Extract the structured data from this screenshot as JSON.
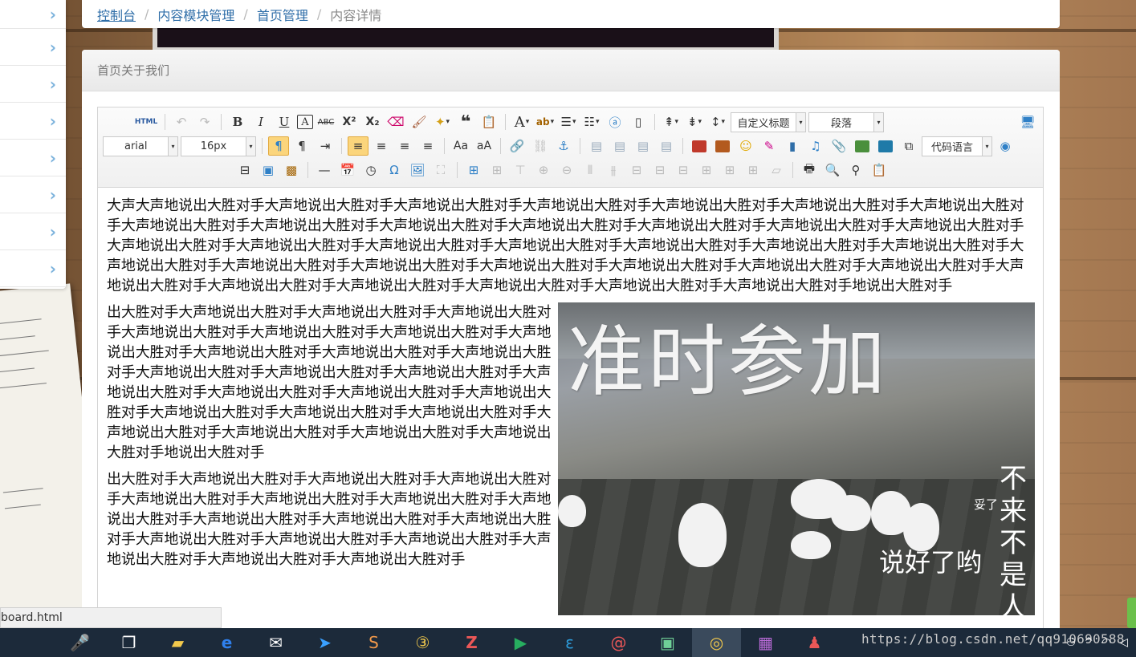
{
  "sidebar": {
    "items": [
      {
        "chevron": "›"
      },
      {
        "chevron": "›"
      },
      {
        "chevron": "›"
      },
      {
        "chevron": "›"
      },
      {
        "chevron": "›"
      },
      {
        "chevron": "›"
      },
      {
        "chevron": "›"
      },
      {
        "chevron": "›"
      }
    ]
  },
  "breadcrumb": {
    "items": [
      "控制台",
      "内容模块管理",
      "首页管理"
    ],
    "separator": "/",
    "current": "内容详情"
  },
  "panel": {
    "title": "首页关于我们"
  },
  "toolbar": {
    "html_label": "HTML",
    "font_family": "arial",
    "font_size": "16px",
    "custom_title": "自定义标题",
    "paragraph": "段落",
    "code_language": "代码语言",
    "row1_icons": [
      "undo-icon",
      "redo-icon",
      "bold-icon",
      "italic-icon",
      "underline-icon",
      "font-border-icon",
      "strikethrough-icon",
      "superscript-icon",
      "subscript-icon",
      "eraser-icon",
      "format-brush-icon",
      "auto-typeset-icon",
      "blockquote-icon",
      "paste-plain-icon",
      "font-color-icon",
      "background-color-icon",
      "ordered-list-icon",
      "unordered-list-icon",
      "select-all-icon",
      "clear-doc-icon",
      "row-spacing-top-icon",
      "row-spacing-bottom-icon",
      "line-height-icon",
      "preview-icon"
    ],
    "glyphs": {
      "bold": "B",
      "italic": "I",
      "underline": "U",
      "fontborder": "A",
      "strike": "ABC",
      "superscript": "X²",
      "subscript": "X₂",
      "quote": "❝",
      "fontcolor": "A",
      "omega": "Ω",
      "hr": "—"
    }
  },
  "content": {
    "paragraph1": "大声大声地说出大胜对手大声地说出大胜对手大声地说出大胜对手大声地说出大胜对手大声地说出大胜对手大声地说出大胜对手大声地说出大胜对手大声地说出大胜对手大声地说出大胜对手大声地说出大胜对手大声地说出大胜对手大声地说出大胜对手大声地说出大胜对手大声地说出大胜对手大声地说出大胜对手大声地说出大胜对手大声地说出大胜对手大声地说出大胜对手大声地说出大胜对手大声地说出大胜对手大声地说出大胜对手大声地说出大胜对手大声地说出大胜对手大声地说出大胜对手大声地说出大胜对手大声地说出大胜对手大声地说出大胜对手大声地说出大胜对手大声地说出大胜对手大声地说出大胜对手大声地说出大胜对手大声地说出大胜对手大声地说出大胜对手大声地说出大胜对手地说出大胜对手",
    "paragraph2": "出大胜对手大声地说出大胜对手大声地说出大胜对手大声地说出大胜对手大声地说出大胜对手大声地说出大胜对手大声地说出大胜对手大声地说出大胜对手大声地说出大胜对手大声地说出大胜对手大声地说出大胜对手大声地说出大胜对手大声地说出大胜对手大声地说出大胜对手大声地说出大胜对手大声地说出大胜对手大声地说出大胜对手大声地说出大胜对手大声地说出大胜对手大声地说出大胜对手大声地说出大胜对手大声地说出大胜对手大声地说出大胜对手大声地说出大胜对手大声地说出大胜对手地说出大胜对手",
    "paragraph3": "出大胜对手大声地说出大胜对手大声地说出大胜对手大声地说出大胜对手大声地说出大胜对手大声地说出大胜对手大声地说出大胜对手大声地说出大胜对手大声地说出大胜对手大声地说出大胜对手大声地说出大胜对手大声地说出大胜对手大声地说出大胜对手大声地说出大胜对手大声地说出大胜对手大声地说出大胜对手大声地说出大胜对手",
    "image": {
      "big_text": "准时参加",
      "small_text": "妥了",
      "bottom_text": "说好了哟",
      "vertical_text": "不来不是人"
    }
  },
  "status_url": "board.html",
  "watermark": "https://blog.csdn.net/qq910690588",
  "taskbar": {
    "icons": [
      "microphone-icon",
      "task-view-icon",
      "file-explorer-icon",
      "edge-icon",
      "mail-icon",
      "feishu-icon",
      "sublime-icon",
      "360-browser-icon",
      "filezilla-icon",
      "media-player-icon",
      "eclipse-icon",
      "snail-icon",
      "wechat-icon",
      "chrome-icon",
      "winrar-icon",
      "qq-icon"
    ]
  }
}
